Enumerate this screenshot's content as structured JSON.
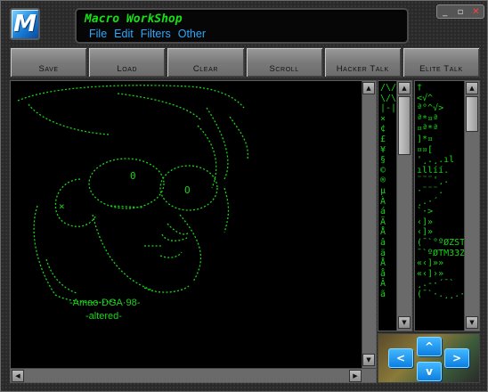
{
  "app": {
    "title": "Macro WorkShop",
    "logo_letter": "M",
    "window_controls": [
      "_",
      "▫",
      "✕"
    ]
  },
  "menu": [
    "File",
    "Edit",
    "Filters",
    "Other"
  ],
  "toolbar": {
    "save": "Save",
    "load": "Load",
    "clear": "Clear",
    "scroll": "Scroll",
    "hacker_talk": "Hacker Talk",
    "elite_talk": "Elite Talk"
  },
  "editor": {
    "caption_line1": "-Amao·DGA·98-",
    "caption_line2": "-altered-",
    "art_eye_left": "0",
    "art_eye_right": "O",
    "art_x": "×"
  },
  "char_list_1": [
    "/\\/\\",
    "\\/\\/",
    "|-|",
    "×",
    "¢",
    "£",
    "¥",
    "§",
    "©",
    "®",
    "µ",
    "À",
    "á",
    "Ä",
    "Å",
    "â",
    "ä",
    "Å",
    "å",
    "Â",
    "ã"
  ],
  "char_list_2": [
    "†",
    "<√^",
    "ª°^√>",
    "ª*¤ª",
    "¤ª*ª",
    "]*¤",
    "¤¤[",
    "'¸.¸.ıl",
    "ıllíí.",
    "¨¨¨'¸.",
    "·¨¨¨.",
    "¸.·´",
    "`·>",
    "‹]»",
    "‹]»",
    "(¯`°ºØZSTM",
    "¯`ºØTM33Zº",
    "«‹]»»",
    "«‹]›»",
    "¸.-·´¯`",
    "(¯`·.¸¸.·´"
  ],
  "colors": {
    "terminal_green": "#19d419",
    "title_green": "#14e014",
    "menu_blue": "#2aa9ff",
    "nav_blue": "#1a8ef0"
  },
  "nav": {
    "up": "^",
    "down": "v",
    "left": "<",
    "right": ">"
  },
  "icons": {
    "scroll_up": "up-arrow-icon",
    "scroll_down": "down-arrow-icon",
    "scroll_left": "left-arrow-icon",
    "scroll_right": "right-arrow-icon"
  }
}
